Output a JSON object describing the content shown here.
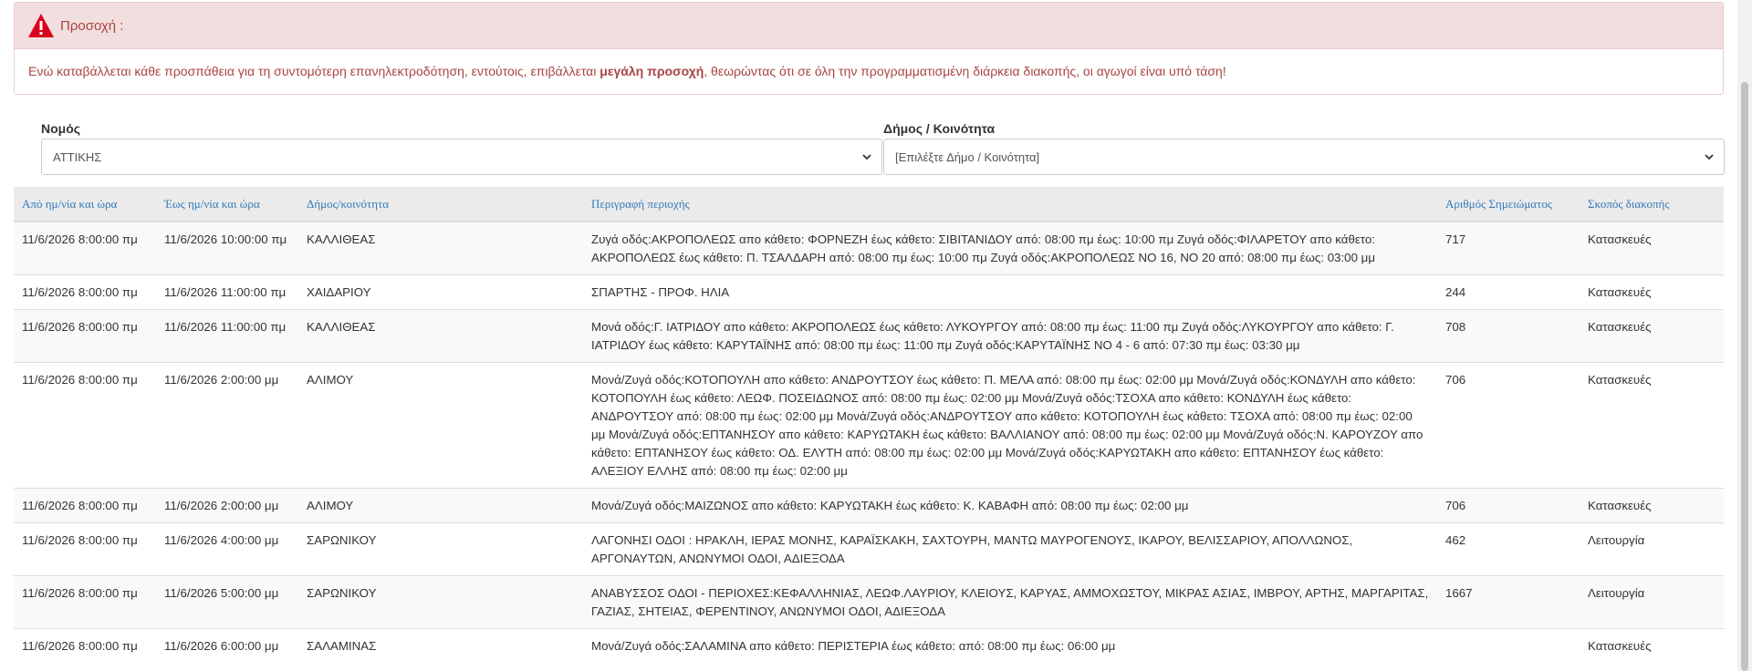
{
  "alert": {
    "title": "Προσοχή :",
    "message_before": "Ενώ καταβάλλεται κάθε προσπάθεια για τη συντομότερη επανηλεκτροδότηση, εντούτοις, επιβάλλεται ",
    "message_bold": "μεγάλη προσοχή",
    "message_after": ", θεωρώντας ότι σε όλη την προγραμματισμένη διάρκεια διακοπής, οι αγωγοί είναι υπό τάση!",
    "icon": "warning-triangle-icon",
    "color": "#a94442",
    "header_bg": "#f2dede"
  },
  "filters": {
    "prefecture_label": "Νομός",
    "prefecture_value": "ΑΤΤΙΚΗΣ",
    "municipality_label": "Δήμος / Κοινότητα",
    "municipality_value": "[Επιλέξτε Δήμο / Κοινότητα]"
  },
  "table": {
    "headers": [
      "Από ημ/νία και ώρα",
      "Έως ημ/νία και ώρα",
      "Δήμος/κοινότητα",
      "Περιγραφή περιοχής",
      "Αριθμός Σημειώματος",
      "Σκοπός διακοπής"
    ],
    "rows": [
      {
        "from": "11/6/2026 8:00:00 πμ",
        "to": "11/6/2026 10:00:00 πμ",
        "municipality": "ΚΑΛΛΙΘΕΑΣ",
        "description": "Ζυγά οδός:ΑΚΡΟΠΟΛΕΩΣ απο κάθετο: ΦΟΡΝΕΖΗ έως κάθετο: ΣΙΒΙΤΑΝΙΔΟΥ από: 08:00 πμ έως: 10:00 πμ Ζυγά οδός:ΦΙΛΑΡΕΤΟΥ απο κάθετο: ΑΚΡΟΠΟΛΕΩΣ έως κάθετο: Π. ΤΣΑΛΔΑΡΗ από: 08:00 πμ έως: 10:00 πμ Ζυγά οδός:ΑΚΡΟΠΟΛΕΩΣ ΝΟ 16, ΝΟ 20 από: 08:00 πμ έως: 03:00 μμ",
        "note": "717",
        "purpose": "Κατασκευές"
      },
      {
        "from": "11/6/2026 8:00:00 πμ",
        "to": "11/6/2026 11:00:00 πμ",
        "municipality": "ΧΑΙΔΑΡΙΟΥ",
        "description": "ΣΠΑΡΤΗΣ - ΠΡΟΦ. ΗΛΙΑ",
        "note": "244",
        "purpose": "Κατασκευές"
      },
      {
        "from": "11/6/2026 8:00:00 πμ",
        "to": "11/6/2026 11:00:00 πμ",
        "municipality": "ΚΑΛΛΙΘΕΑΣ",
        "description": "Μονά οδός:Γ. ΙΑΤΡΙΔΟΥ απο κάθετο: ΑΚΡΟΠΟΛΕΩΣ έως κάθετο: ΛΥΚΟΥΡΓΟΥ από: 08:00 πμ έως: 11:00 πμ Ζυγά οδός:ΛΥΚΟΥΡΓΟΥ απο κάθετο: Γ. ΙΑΤΡΙΔΟΥ έως κάθετο: ΚΑΡΥΤΑΪΝΗΣ από: 08:00 πμ έως: 11:00 πμ Ζυγά οδός:ΚΑΡΥΤΑΪΝΗΣ ΝΟ 4 - 6 από: 07:30 πμ έως: 03:30 μμ",
        "note": "708",
        "purpose": "Κατασκευές"
      },
      {
        "from": "11/6/2026 8:00:00 πμ",
        "to": "11/6/2026 2:00:00 μμ",
        "municipality": "ΑΛΙΜΟΥ",
        "description": "Μονά/Ζυγά οδός:ΚΟΤΟΠΟΥΛΗ απο κάθετο: ΑΝΔΡΟΥΤΣΟΥ έως κάθετο: Π. ΜΕΛΑ από: 08:00 πμ έως: 02:00 μμ Μονά/Ζυγά οδός:ΚΟΝΔΥΛΗ απο κάθετο: ΚΟΤΟΠΟΥΛΗ έως κάθετο: ΛΕΩΦ. ΠΟΣΕΙΔΩΝΟΣ από: 08:00 πμ έως: 02:00 μμ Μονά/Ζυγά οδός:ΤΣΟΧΑ απο κάθετο: ΚΟΝΔΥΛΗ έως κάθετο: ΑΝΔΡΟΥΤΣΟΥ από: 08:00 πμ έως: 02:00 μμ Μονά/Ζυγά οδός:ΑΝΔΡΟΥΤΣΟΥ απο κάθετο: ΚΟΤΟΠΟΥΛΗ έως κάθετο: ΤΣΟΧΑ από: 08:00 πμ έως: 02:00 μμ Μονά/Ζυγά οδός:ΕΠΤΑΝΗΣΟΥ απο κάθετο: ΚΑΡΥΩΤΑΚΗ έως κάθετο: ΒΑΛΛΙΑΝΟΥ από: 08:00 πμ έως: 02:00 μμ Μονά/Ζυγά οδός:Ν. ΚΑΡΟΥΖΟΥ απο κάθετο: ΕΠΤΑΝΗΣΟΥ έως κάθετο: ΟΔ. ΕΛΥΤΗ από: 08:00 πμ έως: 02:00 μμ Μονά/Ζυγά οδός:ΚΑΡΥΩΤΑΚΗ απο κάθετο: ΕΠΤΑΝΗΣΟΥ έως κάθετο: ΑΛΕΞΙΟΥ ΕΛΛΗΣ από: 08:00 πμ έως: 02:00 μμ",
        "note": "706",
        "purpose": "Κατασκευές"
      },
      {
        "from": "11/6/2026 8:00:00 πμ",
        "to": "11/6/2026 2:00:00 μμ",
        "municipality": "ΑΛΙΜΟΥ",
        "description": "Μονά/Ζυγά οδός:ΜΑΙΖΩΝΟΣ απο κάθετο: ΚΑΡΥΩΤΑΚΗ έως κάθετο: Κ. ΚΑΒΑΦΗ από: 08:00 πμ έως: 02:00 μμ",
        "note": "706",
        "purpose": "Κατασκευές"
      },
      {
        "from": "11/6/2026 8:00:00 πμ",
        "to": "11/6/2026 4:00:00 μμ",
        "municipality": "ΣΑΡΩΝΙΚΟΥ",
        "description": "ΛΑΓΟΝΗΣΙ ΟΔΟΙ : ΗΡΑΚΛΗ, ΙΕΡΑΣ ΜΟΝΗΣ, ΚΑΡΑΪΣΚΑΚΗ, ΣΑΧΤΟΥΡΗ, ΜΑΝΤΩ ΜΑΥΡΟΓΕΝΟΥΣ, ΙΚΑΡΟΥ, ΒΕΛΙΣΣΑΡΙΟΥ, ΑΠΟΛΛΩΝΟΣ, ΑΡΓΟΝΑΥΤΩΝ, ΑΝΩΝΥΜΟΙ ΟΔΟΙ, ΑΔΙΕΞΟΔΑ",
        "note": "462",
        "purpose": "Λειτουργία"
      },
      {
        "from": "11/6/2026 8:00:00 πμ",
        "to": "11/6/2026 5:00:00 μμ",
        "municipality": "ΣΑΡΩΝΙΚΟΥ",
        "description": "ΑΝΑΒΥΣΣΟΣ ΟΔΟΙ - ΠΕΡΙΟΧΕΣ:ΚΕΦΑΛΛΗΝΙΑΣ, ΛΕΩΦ.ΛΑΥΡΙΟΥ, ΚΛΕΙΟΥΣ, ΚΑΡΥΑΣ, ΑΜΜΟΧΩΣΤΟΥ, ΜΙΚΡΑΣ ΑΣΙΑΣ, ΙΜΒΡΟΥ, ΑΡΤΗΣ, ΜΑΡΓΑΡΙΤΑΣ, ΓΑΖΙΑΣ, ΣΗΤΕΙΑΣ, ΦΕΡΕΝΤΙΝΟΥ, ΑΝΩΝΥΜΟΙ ΟΔΟΙ, ΑΔΙΕΞΟΔΑ",
        "note": "1667",
        "purpose": "Λειτουργία"
      },
      {
        "from": "11/6/2026 8:00:00 πμ",
        "to": "11/6/2026 6:00:00 μμ",
        "municipality": "ΣΑΛΑΜΙΝΑΣ",
        "description": "Μονά/Ζυγά οδός:ΣΑΛΑΜΙΝΑ απο κάθετο: ΠΕΡΙΣΤΕΡΙΑ έως κάθετο: από: 08:00 πμ έως: 06:00 μμ",
        "note": "",
        "purpose": "Κατασκευές"
      }
    ]
  }
}
